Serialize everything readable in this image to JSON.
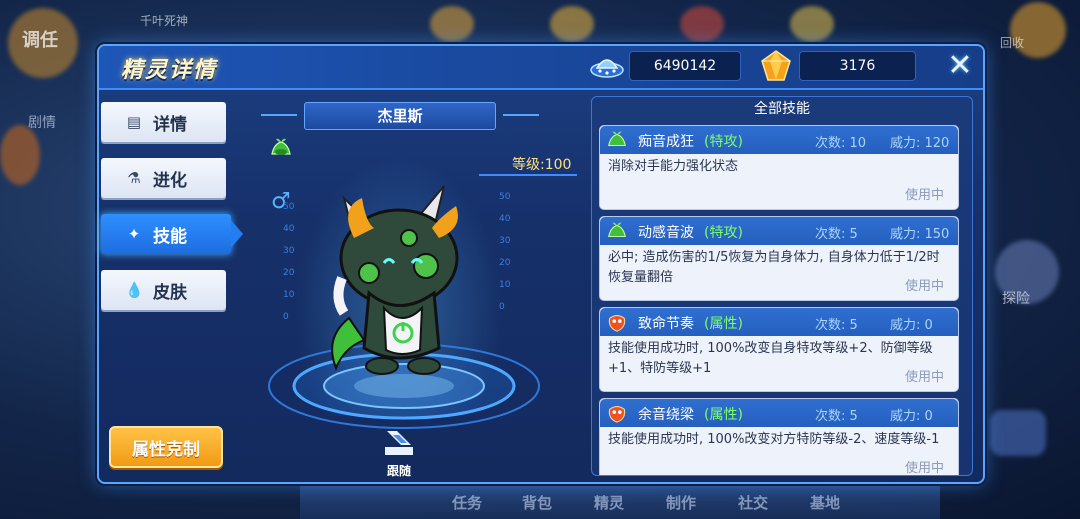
{
  "background": {
    "top_left_badge": "调任",
    "top_text": "千叶死神",
    "left_side_text": "剧情",
    "right_top_text": "回收",
    "right_mid_text": "探险",
    "bottom_nav": [
      "任务",
      "背包",
      "精灵",
      "制作",
      "社交",
      "基地"
    ]
  },
  "dialog": {
    "title": "精灵详情",
    "currency_coins": "6490142",
    "currency_gems": "3176",
    "close_label": "✕"
  },
  "tabs": [
    {
      "label": "详情",
      "icon": "document-icon",
      "glyph": "▤",
      "active": false
    },
    {
      "label": "进化",
      "icon": "flask-icon",
      "glyph": "⚗",
      "active": false
    },
    {
      "label": "技能",
      "icon": "magic-wand-icon",
      "glyph": "✦",
      "active": true
    },
    {
      "label": "皮肤",
      "icon": "droplet-icon",
      "glyph": "💧",
      "active": false
    }
  ],
  "attr_button": "属性克制",
  "pet": {
    "name": "杰里斯",
    "level_text": "等级:100",
    "gender": "♂",
    "type": "grass"
  },
  "ruler_left": [
    "50",
    "40",
    "30",
    "20",
    "10",
    "0"
  ],
  "ruler_right": [
    "50",
    "40",
    "30",
    "20",
    "10",
    "0"
  ],
  "follow_label": "跟随",
  "skills": {
    "header": "全部技能",
    "items": [
      {
        "name": "痴音成狂",
        "category": "(特攻)",
        "count": "次数: 10",
        "power": "威力: 120",
        "desc": "消除对手能力强化状态",
        "status": "使用中",
        "icon": "grass-type-icon"
      },
      {
        "name": "动感音波",
        "category": "(特攻)",
        "count": "次数: 5",
        "power": "威力: 150",
        "desc": "必中; 造成伤害的1/5恢复为自身体力, 自身体力低于1/2时恢复量翻倍",
        "status": "使用中",
        "icon": "grass-type-icon"
      },
      {
        "name": "致命节奏",
        "category": "(属性)",
        "count": "次数: 5",
        "power": "威力: 0",
        "desc": "技能使用成功时, 100%改变自身特攻等级+2、防御等级+1、特防等级+1",
        "status": "使用中",
        "icon": "status-type-icon"
      },
      {
        "name": "余音绕梁",
        "category": "(属性)",
        "count": "次数: 5",
        "power": "威力: 0",
        "desc": "技能使用成功时, 100%改变对方特防等级-2、速度等级-1",
        "status": "使用中",
        "icon": "status-type-icon"
      }
    ]
  }
}
